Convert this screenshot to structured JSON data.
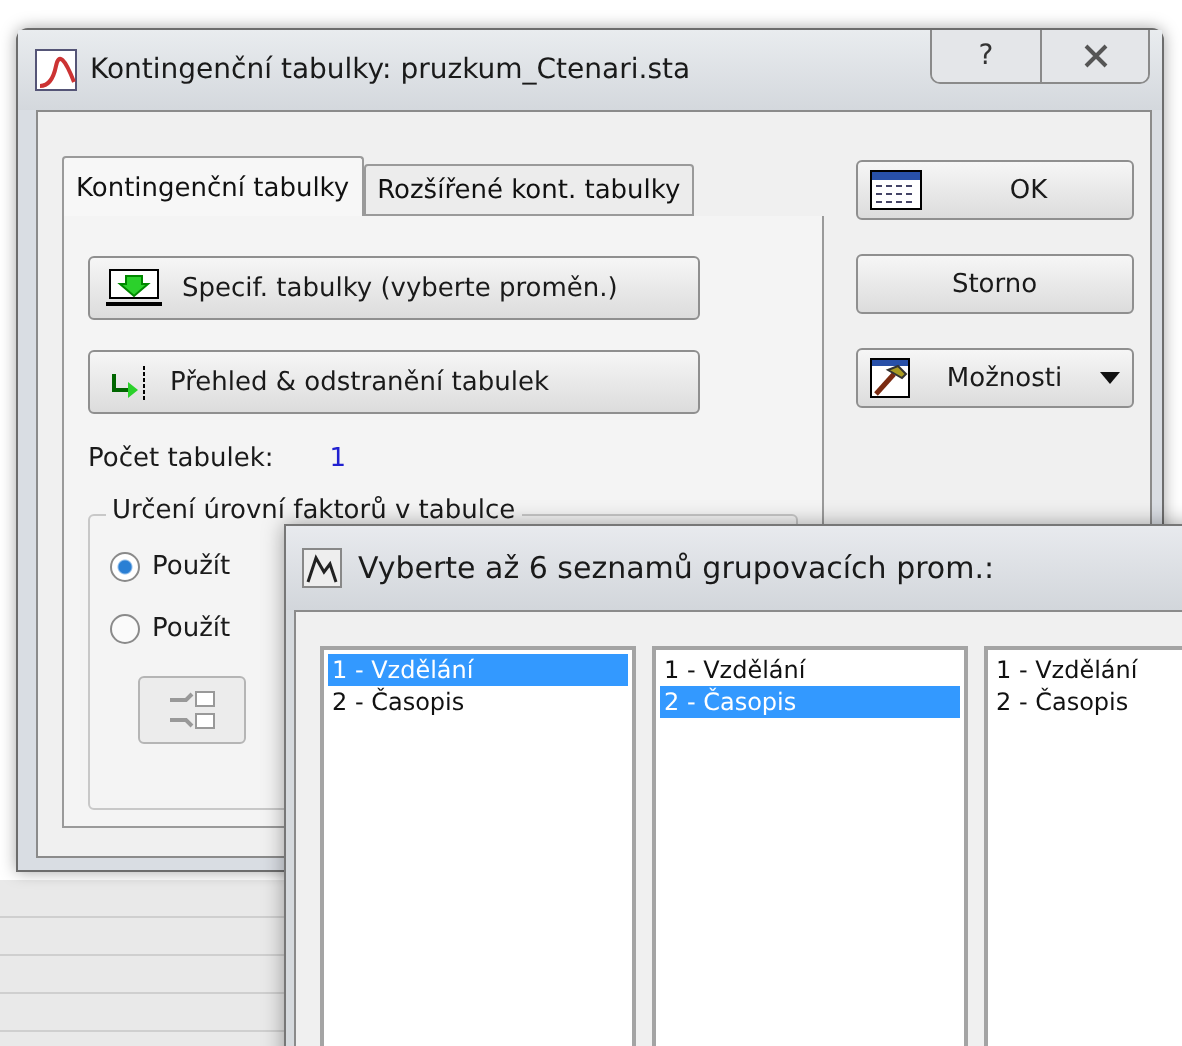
{
  "window": {
    "title": "Kontingenční tabulky: pruzkum_Ctenari.sta",
    "help": "?"
  },
  "tabs": [
    {
      "label": "Kontingenční tabulky",
      "selected": true
    },
    {
      "label": "Rozšířené kont. tabulky",
      "selected": false
    }
  ],
  "panel_buttons": [
    "Specif. tabulky (vyberte proměn.)",
    "Přehled & odstranění tabulek"
  ],
  "count": {
    "label": "Počet tabulek:",
    "value": "1"
  },
  "group": {
    "title": "Určení úrovní faktorů v tabulce",
    "radios": [
      {
        "label": "Použít",
        "selected": true
      },
      {
        "label": "Použít",
        "selected": false
      }
    ]
  },
  "side_buttons": [
    {
      "label": "OK",
      "kind": "table"
    },
    {
      "label": "Storno",
      "kind": "plain"
    },
    {
      "label": "Možnosti",
      "kind": "menu"
    }
  ],
  "dialog": {
    "title": "Vyberte až 6 seznamů grupovacích prom.:",
    "lists": [
      {
        "items": [
          {
            "label": "1 - Vzdělání",
            "selected": true
          },
          {
            "label": "2 - Časopis",
            "selected": false
          }
        ]
      },
      {
        "items": [
          {
            "label": "1 - Vzdělání",
            "selected": false
          },
          {
            "label": "2 - Časopis",
            "selected": true
          }
        ]
      },
      {
        "items": [
          {
            "label": "1 - Vzdělání",
            "selected": false
          },
          {
            "label": "2 - Časopis",
            "selected": false
          }
        ]
      }
    ]
  }
}
